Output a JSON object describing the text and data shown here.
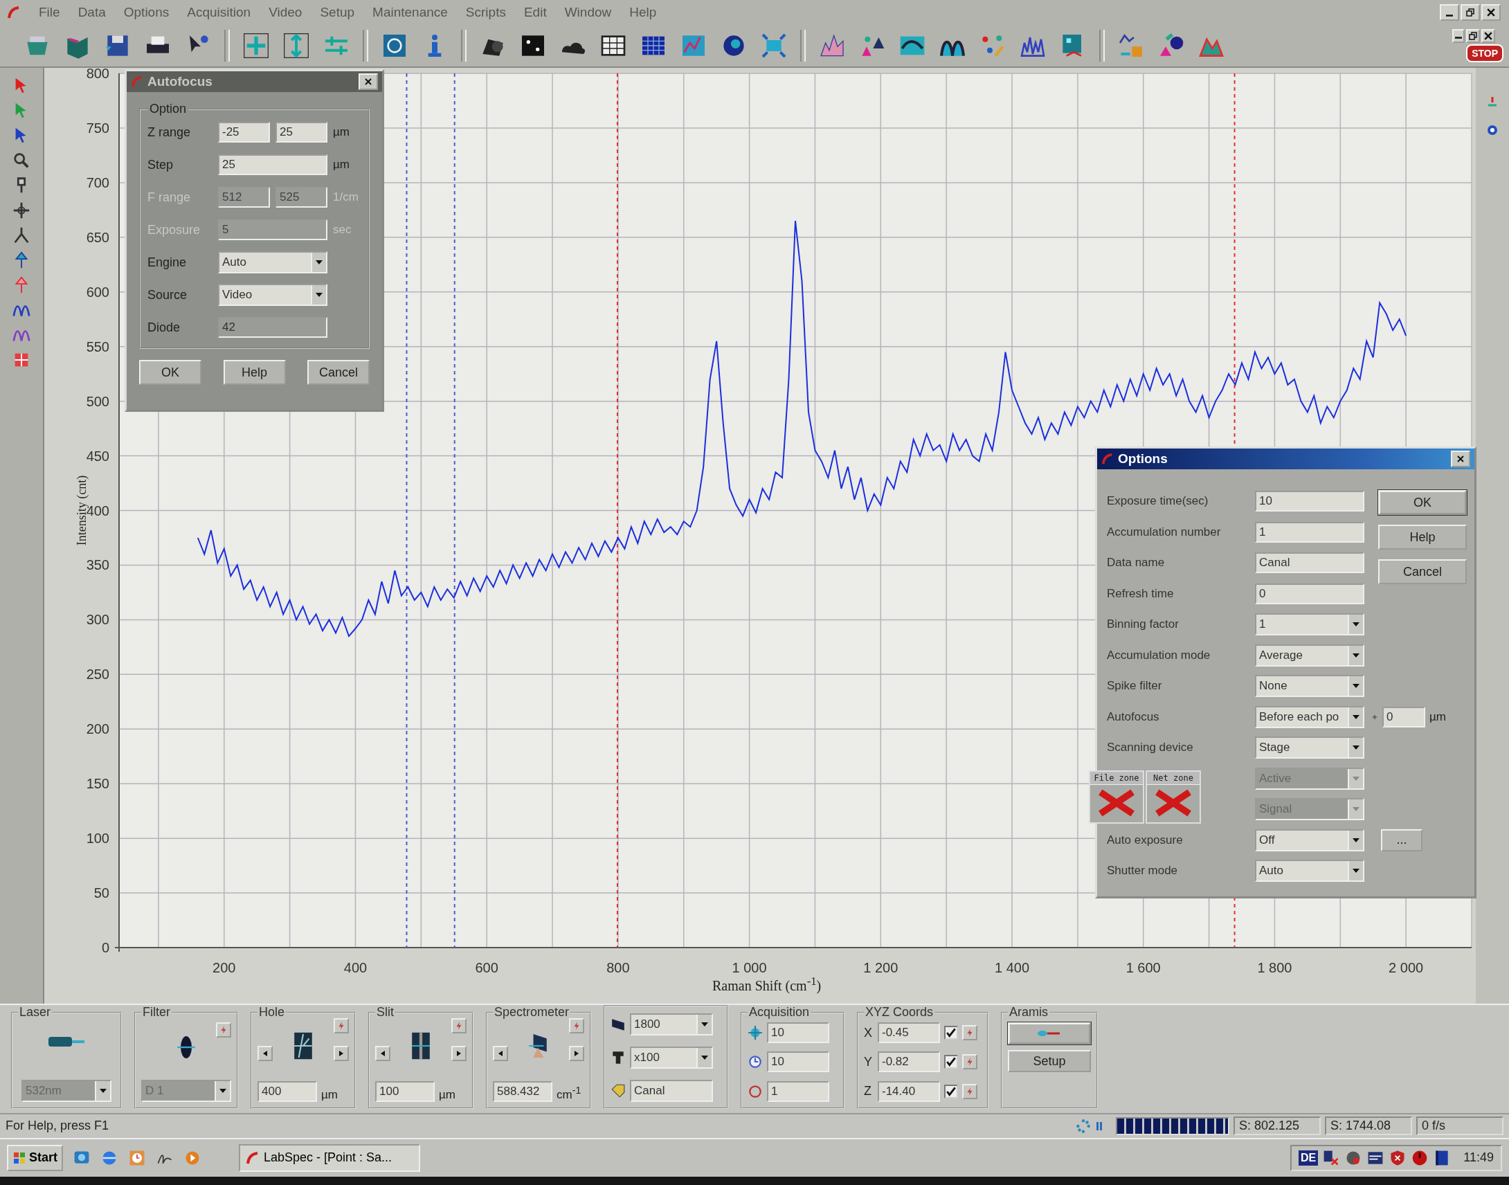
{
  "menus": [
    "File",
    "Data",
    "Options",
    "Acquisition",
    "Video",
    "Setup",
    "Maintenance",
    "Scripts",
    "Edit",
    "Window",
    "Help"
  ],
  "toolbar": {
    "stop": "STOP"
  },
  "chart": {
    "chart_data": {
      "type": "line",
      "grid": true,
      "xlabel": "Raman Shift (cm$^{-1}$)",
      "ylabel": "Intensity (cnt)",
      "xlim": [
        40,
        2100
      ],
      "ylim": [
        0,
        800
      ],
      "xticks": [
        200,
        400,
        600,
        800,
        {
          "value": 1000,
          "label": "1 000"
        },
        {
          "value": 1200,
          "label": "1 200"
        },
        {
          "value": 1400,
          "label": "1 400"
        },
        {
          "value": 1600,
          "label": "1 600"
        },
        {
          "value": 1800,
          "label": "1 800"
        },
        {
          "value": 2000,
          "label": "2 000"
        }
      ],
      "yticks": [
        0,
        50,
        100,
        150,
        200,
        250,
        300,
        350,
        400,
        450,
        500,
        550,
        600,
        650,
        700,
        750,
        800
      ],
      "x": [
        160,
        170,
        180,
        190,
        200,
        210,
        220,
        230,
        240,
        250,
        260,
        270,
        280,
        290,
        300,
        310,
        320,
        330,
        340,
        350,
        360,
        370,
        380,
        390,
        400,
        410,
        420,
        430,
        440,
        450,
        460,
        470,
        480,
        490,
        500,
        510,
        520,
        530,
        540,
        550,
        560,
        570,
        580,
        590,
        600,
        610,
        620,
        630,
        640,
        650,
        660,
        670,
        680,
        690,
        700,
        710,
        720,
        730,
        740,
        750,
        760,
        770,
        780,
        790,
        800,
        810,
        820,
        830,
        840,
        850,
        860,
        870,
        880,
        890,
        900,
        910,
        920,
        930,
        940,
        950,
        960,
        970,
        980,
        990,
        1000,
        1010,
        1020,
        1030,
        1040,
        1050,
        1060,
        1070,
        1080,
        1090,
        1100,
        1110,
        1120,
        1130,
        1140,
        1150,
        1160,
        1170,
        1180,
        1190,
        1200,
        1210,
        1220,
        1230,
        1240,
        1250,
        1260,
        1270,
        1280,
        1290,
        1300,
        1310,
        1320,
        1330,
        1340,
        1350,
        1360,
        1370,
        1380,
        1390,
        1400,
        1410,
        1420,
        1430,
        1440,
        1450,
        1460,
        1470,
        1480,
        1490,
        1500,
        1510,
        1520,
        1530,
        1540,
        1550,
        1560,
        1570,
        1580,
        1590,
        1600,
        1610,
        1620,
        1630,
        1640,
        1650,
        1660,
        1670,
        1680,
        1690,
        1700,
        1710,
        1720,
        1730,
        1740,
        1750,
        1760,
        1770,
        1780,
        1790,
        1800,
        1810,
        1820,
        1830,
        1840,
        1850,
        1860,
        1870,
        1880,
        1890,
        1900,
        1910,
        1920,
        1930,
        1940,
        1950,
        1960,
        1970,
        1980,
        1990,
        2000
      ],
      "series": [
        {
          "color": "#1a2ee0",
          "values": [
            375,
            360,
            382,
            352,
            365,
            340,
            350,
            328,
            336,
            318,
            330,
            312,
            325,
            305,
            318,
            300,
            312,
            296,
            305,
            290,
            300,
            288,
            302,
            285,
            292,
            300,
            318,
            305,
            335,
            315,
            345,
            322,
            330,
            318,
            325,
            312,
            330,
            318,
            328,
            320,
            335,
            322,
            338,
            326,
            340,
            330,
            345,
            333,
            350,
            338,
            352,
            340,
            355,
            345,
            360,
            348,
            362,
            352,
            366,
            355,
            370,
            358,
            372,
            362,
            375,
            365,
            385,
            370,
            390,
            378,
            392,
            380,
            385,
            378,
            390,
            385,
            400,
            440,
            520,
            555,
            480,
            420,
            405,
            395,
            410,
            398,
            420,
            410,
            435,
            430,
            520,
            665,
            610,
            490,
            455,
            445,
            430,
            455,
            420,
            440,
            410,
            430,
            400,
            415,
            405,
            430,
            420,
            445,
            435,
            465,
            450,
            470,
            455,
            460,
            445,
            470,
            455,
            465,
            450,
            445,
            470,
            455,
            490,
            545,
            510,
            495,
            480,
            470,
            485,
            465,
            480,
            470,
            490,
            478,
            495,
            485,
            500,
            490,
            510,
            495,
            515,
            500,
            520,
            505,
            525,
            510,
            530,
            515,
            525,
            505,
            520,
            500,
            490,
            505,
            485,
            500,
            510,
            525,
            515,
            535,
            520,
            545,
            530,
            540,
            525,
            535,
            515,
            520,
            500,
            490,
            505,
            480,
            495,
            485,
            500,
            510,
            530,
            520,
            555,
            540,
            590,
            580,
            565,
            575,
            560
          ]
        }
      ],
      "ref_lines": [
        {
          "axis": "x",
          "value": 478,
          "color": "#4a5ad8"
        },
        {
          "axis": "x",
          "value": 551,
          "color": "#4a5ad8"
        },
        {
          "axis": "x",
          "value": 799,
          "color": "#e03030"
        },
        {
          "axis": "x",
          "value": 1739,
          "color": "#e03030"
        }
      ]
    }
  },
  "autofocus": {
    "title": "Autofocus",
    "active": false,
    "group": "Option",
    "rows": [
      {
        "label": "Z range",
        "kind": "pair",
        "values": [
          "-25",
          "25"
        ],
        "unit": "µm",
        "disabled": false
      },
      {
        "label": "Step",
        "kind": "field",
        "value": "25",
        "unit": "µm",
        "disabled": false
      },
      {
        "label": "F range",
        "kind": "pair",
        "values": [
          "512",
          "525"
        ],
        "unit": "1/cm",
        "disabled": true
      },
      {
        "label": "Exposure",
        "kind": "field",
        "value": "5",
        "unit": "sec",
        "disabled": true
      },
      {
        "label": "Engine",
        "kind": "combo",
        "value": "Auto",
        "disabled": false
      },
      {
        "label": "Source",
        "kind": "combo",
        "value": "Video",
        "disabled": false
      },
      {
        "label": "Diode",
        "kind": "field",
        "value": "42",
        "disabled": false,
        "readonly": true
      }
    ],
    "buttons": [
      {
        "label": "OK",
        "default": false
      },
      {
        "label": "Help",
        "default": false
      },
      {
        "label": "Cancel",
        "default": false
      }
    ]
  },
  "options": {
    "title": "Options",
    "active": true,
    "rows": [
      {
        "label": "Exposure time(sec)",
        "kind": "field",
        "value": "10",
        "disabled": false
      },
      {
        "label": "Accumulation number",
        "kind": "field",
        "value": "1",
        "disabled": false
      },
      {
        "label": "Data name",
        "kind": "field",
        "value": "Canal",
        "disabled": false
      },
      {
        "label": "Refresh time",
        "kind": "field",
        "value": "0",
        "disabled": false
      },
      {
        "label": "Binning factor",
        "kind": "combo",
        "value": "1",
        "disabled": false
      },
      {
        "label": "Accumulation mode",
        "kind": "combo",
        "value": "Average",
        "disabled": false
      },
      {
        "label": "Spike filter",
        "kind": "combo",
        "value": "None",
        "disabled": false
      },
      {
        "label": "Autofocus",
        "kind": "combo",
        "value": "Before each po",
        "disabled": false,
        "extra_field": "0",
        "extra_unit": "µm"
      },
      {
        "label": "Scanning device",
        "kind": "combo",
        "value": "Stage",
        "disabled": false
      },
      {
        "kind": "combo",
        "value": "Active",
        "disabled": true
      },
      {
        "kind": "combo",
        "value": "Signal",
        "disabled": true
      },
      {
        "label": "Auto exposure",
        "kind": "combo",
        "value": "Off",
        "disabled": false,
        "extra_button": "..."
      },
      {
        "label": "Shutter mode",
        "kind": "combo",
        "value": "Auto",
        "disabled": false
      }
    ],
    "buttons": [
      {
        "label": "OK",
        "default": true
      },
      {
        "label": "Help",
        "default": false
      },
      {
        "label": "Cancel",
        "default": false
      }
    ]
  },
  "zones": [
    {
      "label": "File zone"
    },
    {
      "label": "Net zone"
    }
  ],
  "panel": {
    "laser": {
      "title": "Laser",
      "value": "532nm",
      "disabled": true
    },
    "filter": {
      "title": "Filter",
      "value": "D 1",
      "disabled": true
    },
    "hole": {
      "title": "Hole",
      "value": "400",
      "unit": "µm"
    },
    "slit": {
      "title": "Slit",
      "value": "100",
      "unit": "µm"
    },
    "spectrometer": {
      "title": "Spectrometer",
      "value": "588.432",
      "unit": "cm$^{-1}$"
    },
    "grating": {
      "grating": "1800",
      "objective": "x100",
      "data_name": "Canal"
    },
    "acquisition": {
      "title": "Acquisition",
      "fields": [
        {
          "kind": "spot",
          "value": "10"
        },
        {
          "kind": "time",
          "value": "10"
        },
        {
          "kind": "loop",
          "value": "1"
        }
      ]
    },
    "xyz": {
      "title": "XYZ Coords",
      "axes": [
        {
          "label": "X",
          "value": "-0.45",
          "checked": true
        },
        {
          "label": "Y",
          "value": "-0.82",
          "checked": true
        },
        {
          "label": "Z",
          "value": "-14.40",
          "checked": true
        }
      ]
    },
    "aramis": {
      "title": "Aramis",
      "setup": "Setup"
    }
  },
  "status_bar": {
    "help": "For Help, press F1",
    "progress": {
      "level": 1
    },
    "readouts": [
      "S: 802.125",
      "S: 1744.08",
      "0 f/s"
    ]
  },
  "taskbar": {
    "start": "Start",
    "task": "LabSpec - [Point : Sa...",
    "lang": "DE",
    "clock": "11:49"
  }
}
